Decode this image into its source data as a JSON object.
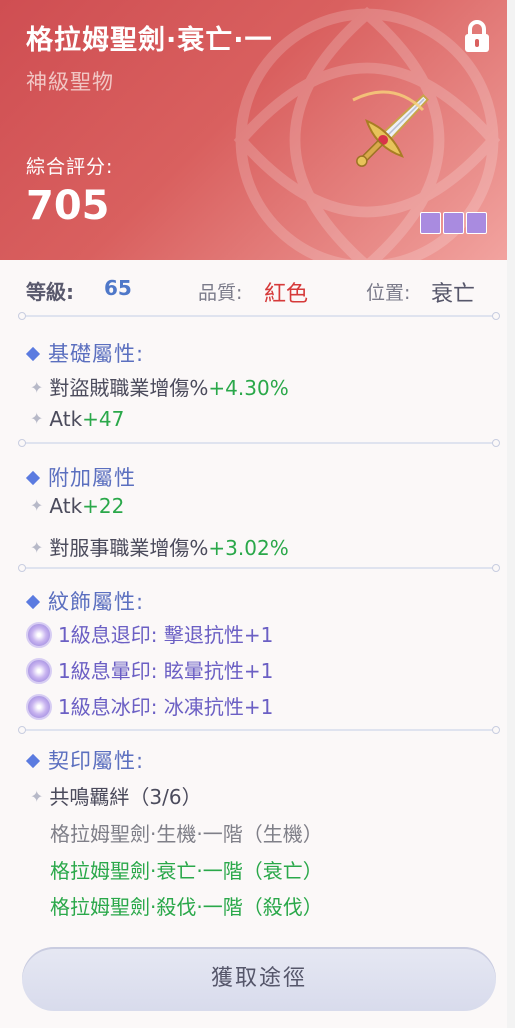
{
  "item": {
    "name": "格拉姆聖劍·衰亡·一",
    "rarity": "神級聖物",
    "score_label": "綜合評分:",
    "score": "705",
    "slots": 3
  },
  "info": {
    "level_label": "等級:",
    "level": "65",
    "quality_label": "品質:",
    "quality": "紅色",
    "position_label": "位置:",
    "position": "衰亡"
  },
  "base": {
    "title": "基礎屬性:",
    "lines": [
      {
        "name": "對盜賊職業增傷%",
        "value": "+4.30%"
      },
      {
        "name": "Atk",
        "value": "+47"
      }
    ]
  },
  "extra": {
    "title": "附加屬性",
    "lines": [
      {
        "name": "Atk",
        "value": "+22"
      },
      {
        "name": "對服事職業增傷%",
        "value": "+3.02%"
      }
    ]
  },
  "pattern": {
    "title": "紋飾屬性:",
    "lines": [
      "1級息退印: 擊退抗性+1",
      "1級息暈印: 眩暈抗性+1",
      "1級息冰印: 冰凍抗性+1"
    ]
  },
  "seal": {
    "title": "契印屬性:",
    "resonance": "共鳴羈絆（3/6）",
    "sets": [
      {
        "text": "格拉姆聖劍·生機·一階（生機）",
        "active": false
      },
      {
        "text": "格拉姆聖劍·衰亡·一階（衰亡）",
        "active": true
      },
      {
        "text": "格拉姆聖劍·殺伐·一階（殺伐）",
        "active": true
      }
    ]
  },
  "button": {
    "label": "獲取途徑"
  },
  "colors": {
    "header": "#d9605f",
    "accent_blue": "#5b6fbf",
    "green": "#2aa84a",
    "red": "#d63a3a",
    "slot": "#a98be0"
  }
}
